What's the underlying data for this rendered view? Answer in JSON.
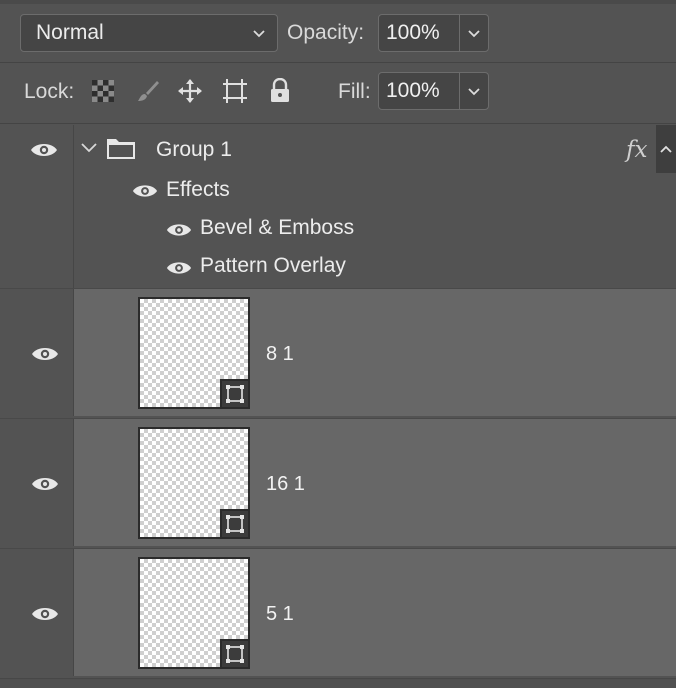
{
  "header": {
    "blend_mode": "Normal",
    "opacity_label": "Opacity:",
    "opacity_value": "100%",
    "lock_label": "Lock:",
    "fill_label": "Fill:",
    "fill_value": "100%"
  },
  "icons": {
    "lock_transparent": "checkerboard-icon",
    "lock_image": "brush-icon",
    "lock_position": "move-icon",
    "lock_artboard": "artboard-icon",
    "lock_all": "padlock-icon"
  },
  "group": {
    "name": "Group 1",
    "fx": "fx",
    "effects_label": "Effects",
    "effects": [
      {
        "name": "Bevel & Emboss"
      },
      {
        "name": "Pattern Overlay"
      }
    ]
  },
  "layers": [
    {
      "name": "8 1"
    },
    {
      "name": "16 1"
    },
    {
      "name": "5 1"
    }
  ],
  "colors": {
    "panel_bg": "#535353",
    "layer_bg": "#676767",
    "field_bg": "#454545"
  }
}
